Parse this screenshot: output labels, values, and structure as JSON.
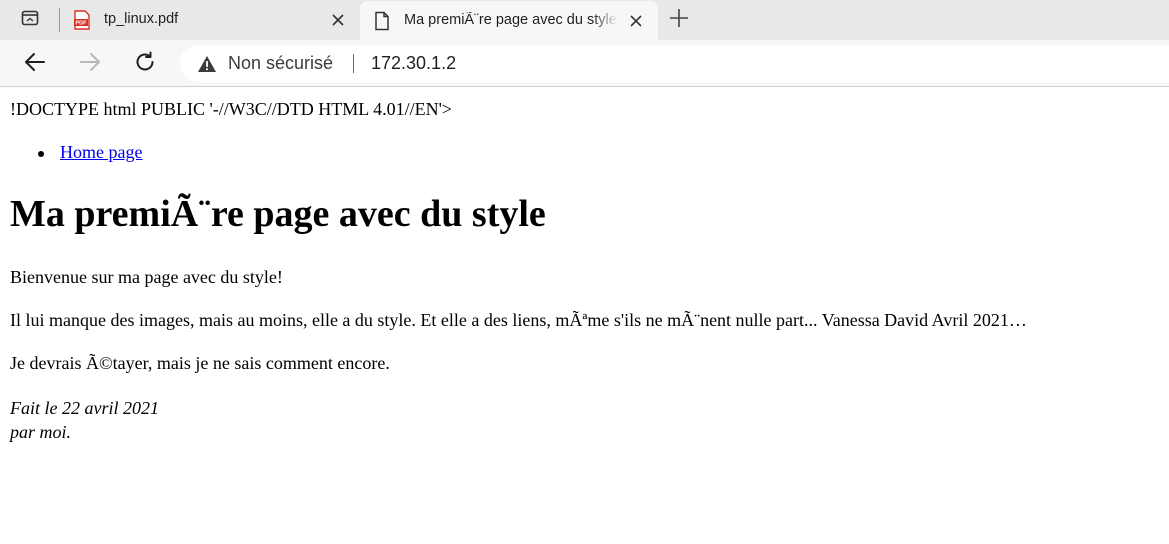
{
  "browser": {
    "tabs": [
      {
        "title": "tp_linux.pdf",
        "favicon": "pdf-icon",
        "active": false
      },
      {
        "title": "Ma premiÃ¨re page avec du style",
        "favicon": "page-icon",
        "active": true
      }
    ],
    "omnibox": {
      "security_label": "Non sécurisé",
      "url": "172.30.1.2"
    },
    "icons": {
      "tab_actions": "tab-actions-icon",
      "close": "close-icon",
      "new_tab": "plus-icon",
      "back": "back-arrow-icon",
      "forward": "forward-arrow-icon",
      "reload": "reload-icon",
      "security": "warning-icon"
    }
  },
  "page": {
    "doctype_text": "!DOCTYPE html PUBLIC '-//W3C//DTD HTML 4.01//EN'>",
    "nav": [
      {
        "label": "Home page"
      }
    ],
    "heading": "Ma premiÃ¨re page avec du style",
    "paragraphs": [
      "Bienvenue sur ma page avec du style!",
      "Il lui manque des images, mais au moins, elle a du style. Et elle a des liens, mÃªme s'ils ne mÃ¨nent nulle part... Vanessa David Avril 2021…",
      "Je devrais Ã©tayer, mais je ne sais comment encore."
    ],
    "footer": {
      "line1": "Fait le 22 avril 2021",
      "line2": "par moi."
    }
  },
  "colors": {
    "tabstrip_bg": "#e8e8e8",
    "toolbar_bg": "#f7f7f7",
    "link": "#0000ee",
    "pdf_red": "#d93025"
  }
}
